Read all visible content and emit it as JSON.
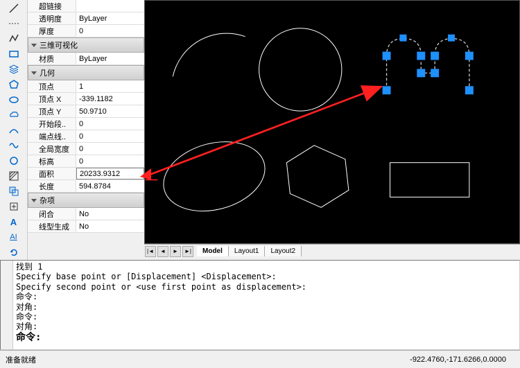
{
  "toolbar": {
    "items": [
      "line",
      "polyline",
      "circle",
      "arc",
      "rectangle",
      "layers",
      "polygon",
      "ellipse",
      "cloud",
      "spline",
      "hatch",
      "region",
      "insert",
      "curve",
      "text-a",
      "text",
      "refresh"
    ]
  },
  "properties": {
    "section_hyperlink": "超链接",
    "transparency": {
      "label": "透明度",
      "value": "ByLayer"
    },
    "thickness": {
      "label": "厚度",
      "value": "0"
    },
    "section_3d": "三维可视化",
    "material": {
      "label": "材质",
      "value": "ByLayer"
    },
    "section_geometry": "几何",
    "vertex": {
      "label": "顶点",
      "value": "1"
    },
    "vertex_x": {
      "label": "顶点 X",
      "value": "-339.1182"
    },
    "vertex_y": {
      "label": "顶点 Y",
      "value": "50.9710"
    },
    "start_seg": {
      "label": "开始段..",
      "value": "0"
    },
    "end_line": {
      "label": "端点线..",
      "value": "0"
    },
    "global_width": {
      "label": "全局宽度",
      "value": "0"
    },
    "elevation": {
      "label": "标高",
      "value": "0"
    },
    "area": {
      "label": "面积",
      "value": "20233.9312"
    },
    "length": {
      "label": "长度",
      "value": "594.8784"
    },
    "section_misc": "杂项",
    "closed": {
      "label": "闭合",
      "value": "No"
    },
    "linetype_gen": {
      "label": "线型生成",
      "value": "No"
    }
  },
  "tabs": {
    "model": "Model",
    "layout1": "Layout1",
    "layout2": "Layout2"
  },
  "command": {
    "history": "找到 1\nSpecify base point or [Displacement] <Displacement>:\nSpecify second point or <use first point as displacement>:\n命令:\n对角:\n命令:\n对角:",
    "prompt": "命令:"
  },
  "status": {
    "ready": "准备就绪",
    "coords": "-922.4760,-171.6266,0.0000"
  },
  "colors": {
    "grip": "#1e90ff",
    "dashed": "#aaa",
    "arrow": "#ff2020"
  }
}
